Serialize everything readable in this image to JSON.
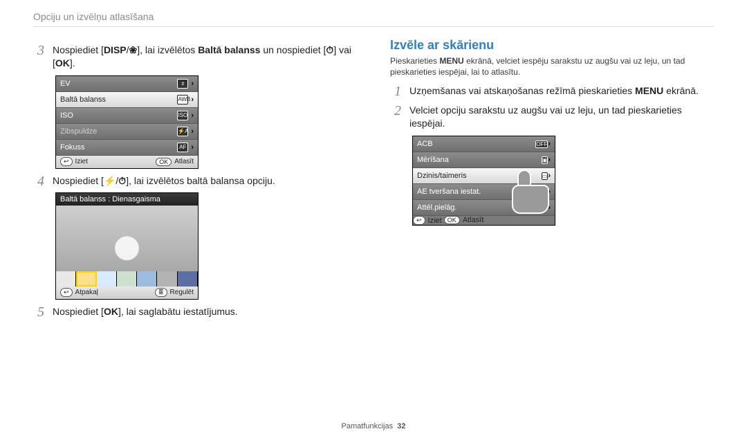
{
  "header": {
    "title": "Opciju un izvēlņu atlasīšana"
  },
  "glyphs": {
    "disp": "DISP",
    "macro": "❀",
    "timer": "⏱",
    "ok": "OK",
    "flash": "⚡",
    "flashA": "⚡A",
    "awb": "AWB",
    "iso": "ISO",
    "af": "AF",
    "menu": "≣",
    "menuWord": "MENU",
    "coff": "OFF"
  },
  "left": {
    "step3": {
      "num": "3",
      "pre": "Nospiediet ",
      "mid1": ", lai izvēlētos ",
      "bold": "Baltā balanss",
      "mid2": " un nospiediet ",
      "mid3": " vai "
    },
    "menu": [
      "EV",
      "Baltā balanss",
      "ISO",
      "Zibspuldze",
      "Fokuss"
    ],
    "soft": {
      "back": "Iziet",
      "select": "Atlasīt",
      "back2": "Atpakaļ",
      "adjust": "Regulēt"
    },
    "step4": {
      "num": "4",
      "pre": "Nospiediet ",
      "post": ", lai izvēlētos baltā balansa opciju."
    },
    "wb": {
      "title": "Baltā balanss : Dienasgaisma"
    },
    "step5": {
      "num": "5",
      "pre": "Nospiediet ",
      "post": ", lai saglabātu iestatījumus."
    }
  },
  "right": {
    "heading": "Izvēle ar skārienu",
    "intro": {
      "pre": "Pieskarieties ",
      "post": " ekrānā, velciet iespēju sarakstu uz augšu vai uz leju, un tad pieskarieties iespējai, lai to atlasītu."
    },
    "step1": {
      "num": "1",
      "pre": "Uzņemšanas vai atskaņošanas režīmā pieskarieties ",
      "post": " ekrānā."
    },
    "step2": {
      "num": "2",
      "text": "Velciet opciju sarakstu uz augšu vai uz leju, un tad pieskarieties iespējai."
    },
    "menu": [
      "ACB",
      "Mērīšana",
      "Dzinis/taimeris",
      "AE tveršana iestat.",
      "Attēl.pielāg."
    ],
    "soft": {
      "back": "Iziet",
      "select": "Atlasīt"
    }
  },
  "footer": {
    "section": "Pamatfunkcijas",
    "page": "32"
  }
}
